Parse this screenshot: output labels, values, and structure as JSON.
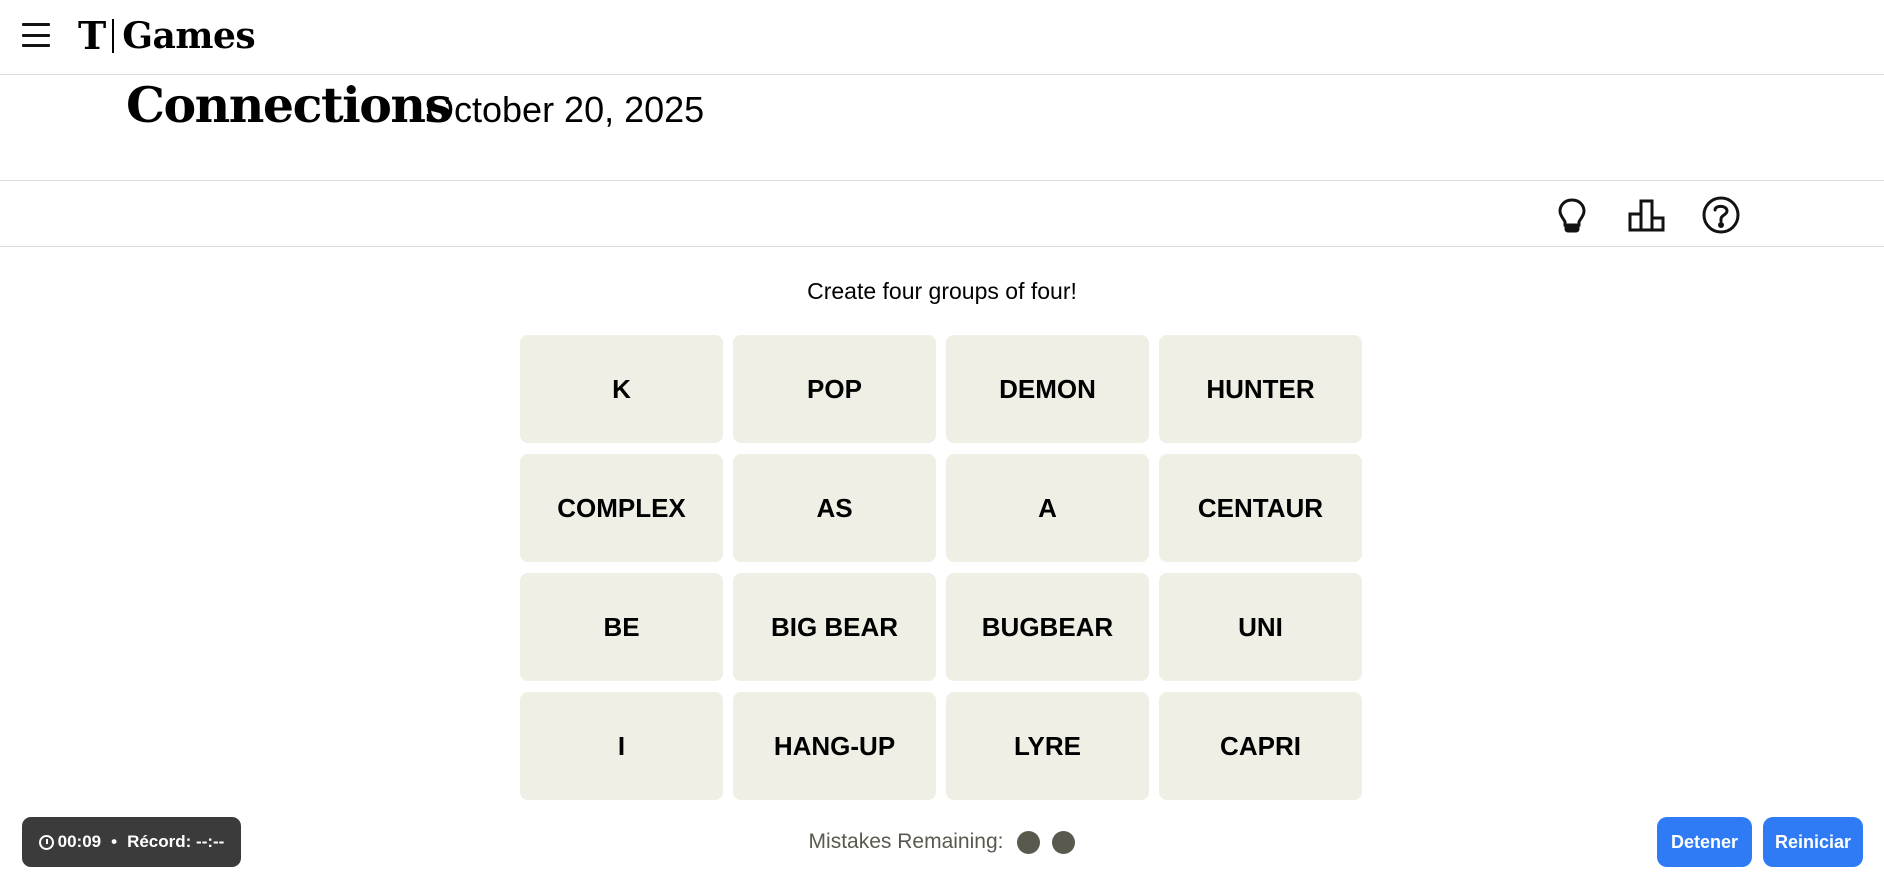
{
  "header": {
    "menu_icon": "hamburger-menu-icon",
    "logo_mark": "T",
    "logo_text": "Games"
  },
  "title": {
    "game_name": "Connections",
    "date": "October 20, 2025"
  },
  "toolbar": {
    "icons": [
      "lightbulb-icon",
      "leaderboard-icon",
      "help-icon"
    ]
  },
  "instruction": "Create four groups of four!",
  "tiles": [
    [
      "K",
      "POP",
      "DEMON",
      "HUNTER"
    ],
    [
      "COMPLEX",
      "AS",
      "A",
      "CENTAUR"
    ],
    [
      "BE",
      "BIG BEAR",
      "BUGBEAR",
      "UNI"
    ],
    [
      "I",
      "HANG-UP",
      "LYRE",
      "CAPRI"
    ]
  ],
  "mistakes": {
    "label": "Mistakes Remaining:",
    "remaining": 2
  },
  "timer": {
    "elapsed": "00:09",
    "separator": "•",
    "record_label": "Récord: --:--"
  },
  "buttons": {
    "stop": "Detener",
    "restart": "Reiniciar"
  },
  "colors": {
    "tile_bg": "#efefe6",
    "dot": "#5a594e",
    "button_blue": "#2f7bf5",
    "timer_bg": "#3b3b3b"
  }
}
